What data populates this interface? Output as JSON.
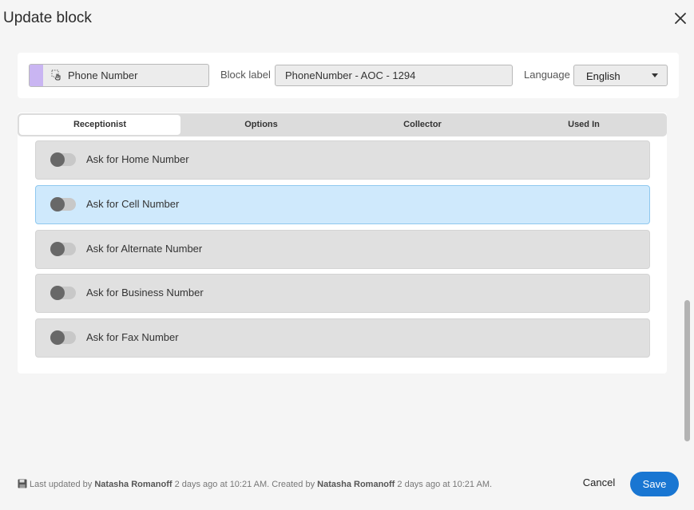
{
  "dialog": {
    "title": "Update block"
  },
  "header": {
    "block_type": "Phone Number",
    "block_label_caption": "Block label",
    "block_label_value": "PhoneNumber - AOC - 1294",
    "language_caption": "Language",
    "language_value": "English"
  },
  "tabs": [
    {
      "label": "Receptionist",
      "active": true
    },
    {
      "label": "Options",
      "active": false
    },
    {
      "label": "Collector",
      "active": false
    },
    {
      "label": "Used In",
      "active": false
    }
  ],
  "options": [
    {
      "label": "Ask for Home Number",
      "enabled": false,
      "selected": false
    },
    {
      "label": "Ask for Cell Number",
      "enabled": false,
      "selected": true
    },
    {
      "label": "Ask for Alternate Number",
      "enabled": false,
      "selected": false
    },
    {
      "label": "Ask for Business Number",
      "enabled": false,
      "selected": false
    },
    {
      "label": "Ask for Fax Number",
      "enabled": false,
      "selected": false
    }
  ],
  "footer": {
    "prefix": "Last updated by ",
    "updated_by": "Natasha Romanoff",
    "updated_time": " 2 days ago at 10:21 AM. Created by ",
    "created_by": "Natasha Romanoff",
    "created_time": " 2 days ago at 10:21 AM.",
    "cancel_label": "Cancel",
    "save_label": "Save"
  },
  "colors": {
    "accent": "#1976d2",
    "block_type_swatch": "#c9b5f2",
    "selected_row": "#cfe9fc"
  },
  "icons": {
    "close": "close-icon",
    "block_type": "touch-select-icon",
    "language_dropdown": "caret-down-icon",
    "footer": "floppy-disk-icon"
  }
}
